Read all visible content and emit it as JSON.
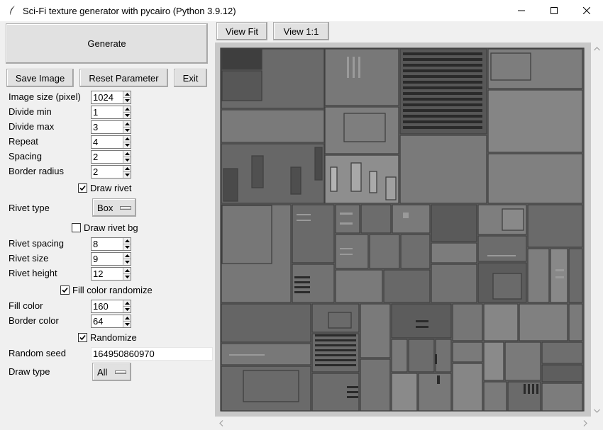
{
  "window": {
    "title": "Sci-Fi texture generator with pycairo (Python 3.9.12)",
    "feather_icon": "feather-icon",
    "minimize_icon": "minimize-icon",
    "maximize_icon": "maximize-icon",
    "close_icon": "close-icon"
  },
  "buttons": {
    "generate": "Generate",
    "save_image": "Save Image",
    "reset_parameter": "Reset Parameter",
    "exit": "Exit",
    "view_fit": "View Fit",
    "view_1_1": "View 1:1"
  },
  "params": {
    "image_size_label": "Image size (pixel)",
    "image_size": "1024",
    "divide_min_label": "Divide min",
    "divide_min": "1",
    "divide_max_label": "Divide max",
    "divide_max": "3",
    "repeat_label": "Repeat",
    "repeat": "4",
    "spacing_label": "Spacing",
    "spacing": "2",
    "border_radius_label": "Border radius",
    "border_radius": "2",
    "draw_rivet_label": "Draw rivet",
    "draw_rivet": true,
    "rivet_type_label": "Rivet type",
    "rivet_type": "Box",
    "draw_rivet_bg_label": "Draw rivet bg",
    "draw_rivet_bg": false,
    "rivet_spacing_label": "Rivet spacing",
    "rivet_spacing": "8",
    "rivet_size_label": "Rivet size",
    "rivet_size": "9",
    "rivet_height_label": "Rivet height",
    "rivet_height": "12",
    "fill_color_randomize_label": "Fill color randomize",
    "fill_color_randomize": true,
    "fill_color_label": "Fill color",
    "fill_color": "160",
    "border_color_label": "Border color",
    "border_color": "64",
    "randomize_label": "Randomize",
    "randomize": true,
    "random_seed_label": "Random seed",
    "random_seed": "164950860970",
    "draw_type_label": "Draw type",
    "draw_type": "All"
  },
  "colors": {
    "canvas_bg": "#c8c8c8",
    "panel_border": "#404040"
  }
}
